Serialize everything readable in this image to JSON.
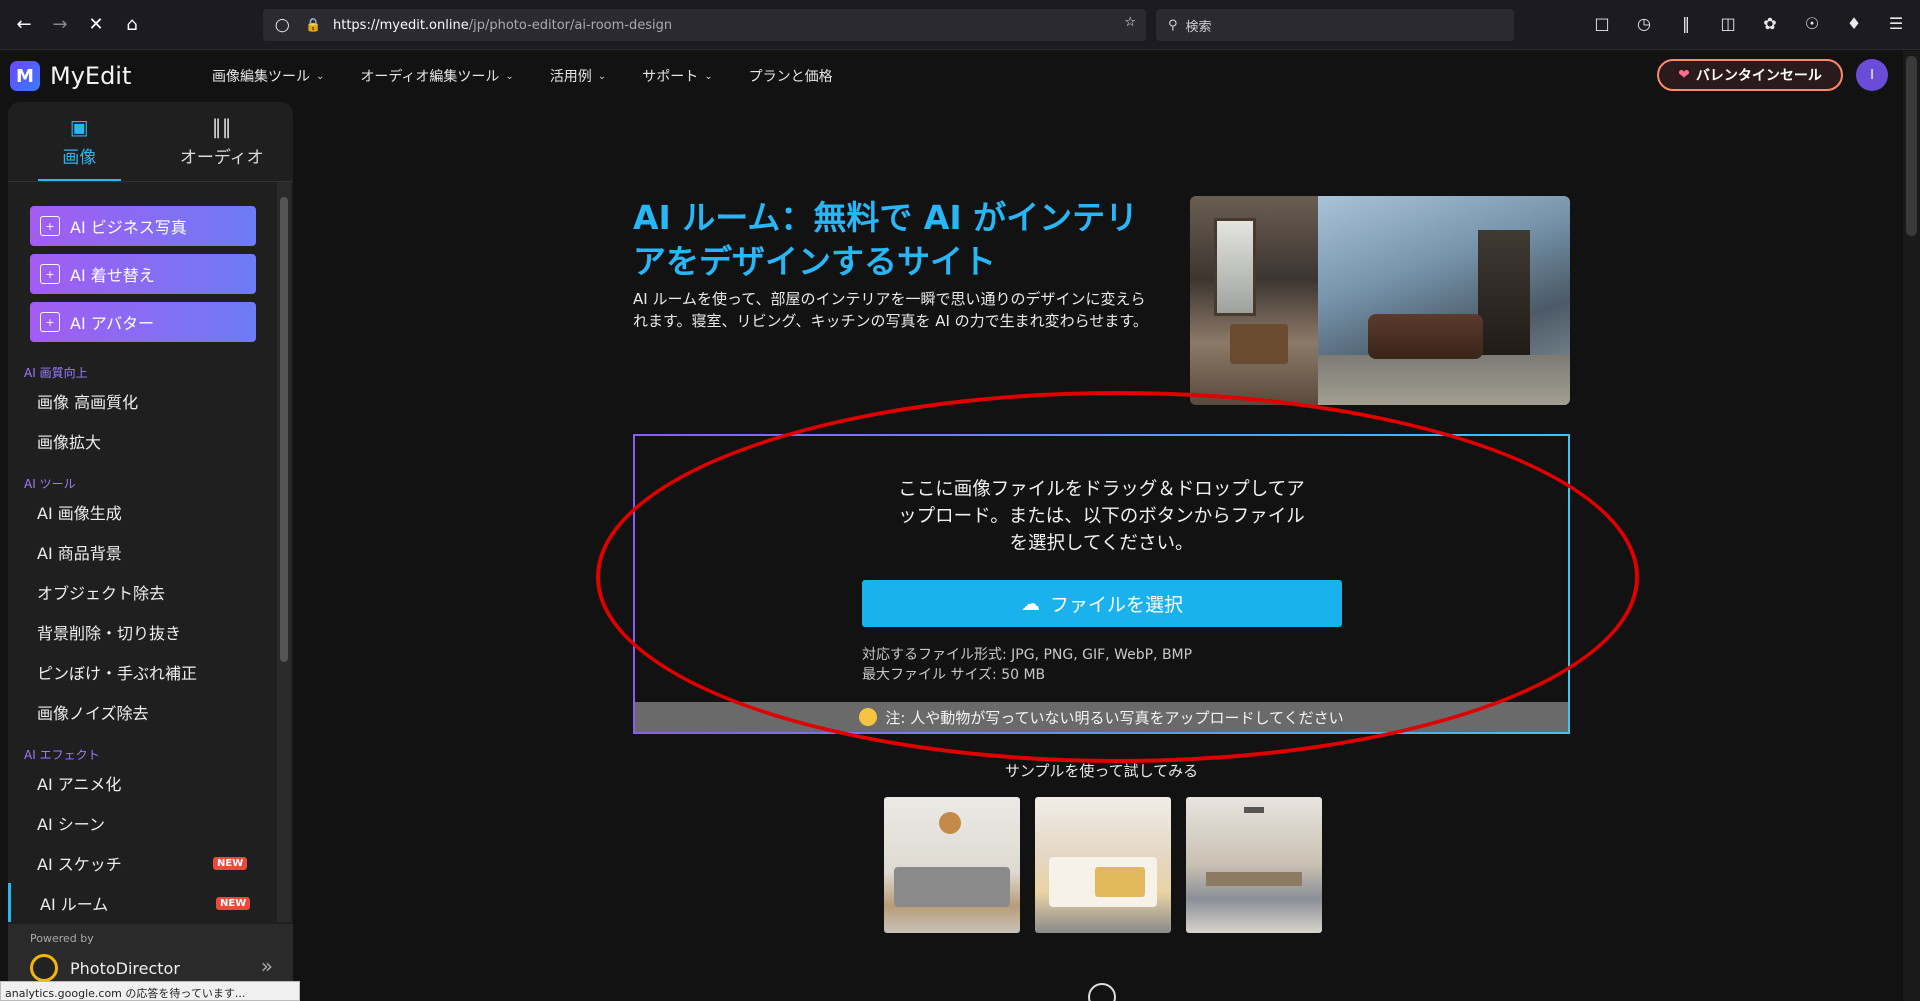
{
  "browser": {
    "url_host": "https://myedit.online",
    "url_path": "/jp/photo-editor/ai-room-design",
    "search_placeholder": "検索"
  },
  "app": {
    "logo_text": "MyEdit",
    "nav": [
      "画像編集ツール",
      "オーディオ編集ツール",
      "活用例",
      "サポート",
      "プランと価格"
    ],
    "sale_label": "バレンタインセール",
    "avatar_initial": "I"
  },
  "sidebar": {
    "tabs": [
      {
        "label": "画像",
        "icon": "image-icon",
        "active": true
      },
      {
        "label": "オーディオ",
        "icon": "waveform-icon",
        "active": false
      }
    ],
    "ai_buttons": [
      "AI ビジネス写真",
      "AI 着せ替え",
      "AI アバター"
    ],
    "sections": [
      {
        "title": "AI 画質向上",
        "items": [
          {
            "label": "画像 高画質化"
          },
          {
            "label": "画像拡大"
          }
        ]
      },
      {
        "title": "AI ツール",
        "items": [
          {
            "label": "AI 画像生成"
          },
          {
            "label": "AI 商品背景"
          },
          {
            "label": "オブジェクト除去"
          },
          {
            "label": "背景削除・切り抜き"
          },
          {
            "label": "ピンぼけ・手ぶれ補正"
          },
          {
            "label": "画像ノイズ除去"
          }
        ]
      },
      {
        "title": "AI エフェクト",
        "items": [
          {
            "label": "AI アニメ化"
          },
          {
            "label": "AI シーン"
          },
          {
            "label": "AI スケッチ",
            "badge": "NEW"
          },
          {
            "label": "AI ルーム",
            "badge": "NEW"
          }
        ]
      }
    ],
    "powered_by": "Powered by",
    "powered_product": "PhotoDirector"
  },
  "status_text": "analytics.google.com の応答を待っています...",
  "main": {
    "title": "AI ルーム：無料で AI がインテリアをデザインするサイト",
    "description": "AI ルームを使って、部屋のインテリアを一瞬で思い通りのデザインに変えられます。寝室、リビング、キッチンの写真を AI の力で生まれ変わらせます。",
    "upload_text": "ここに画像ファイルをドラッグ＆ドロップしてアップロード。または、以下のボタンからファイルを選択してください。",
    "upload_button": "ファイルを選択",
    "file_formats": "対応するファイル形式: JPG, PNG, GIF, WebP, BMP",
    "max_size": "最大ファイル サイズ: 50 MB",
    "note": "注: 人や動物が写っていない明るい写真をアップロードしてください",
    "sample_title": "サンプルを使って試してみる"
  },
  "colors": {
    "accent": "#29b6f6",
    "button": "#1ab2ec",
    "ai_gradient_start": "#a35cf2",
    "annotation": "#e00000"
  }
}
